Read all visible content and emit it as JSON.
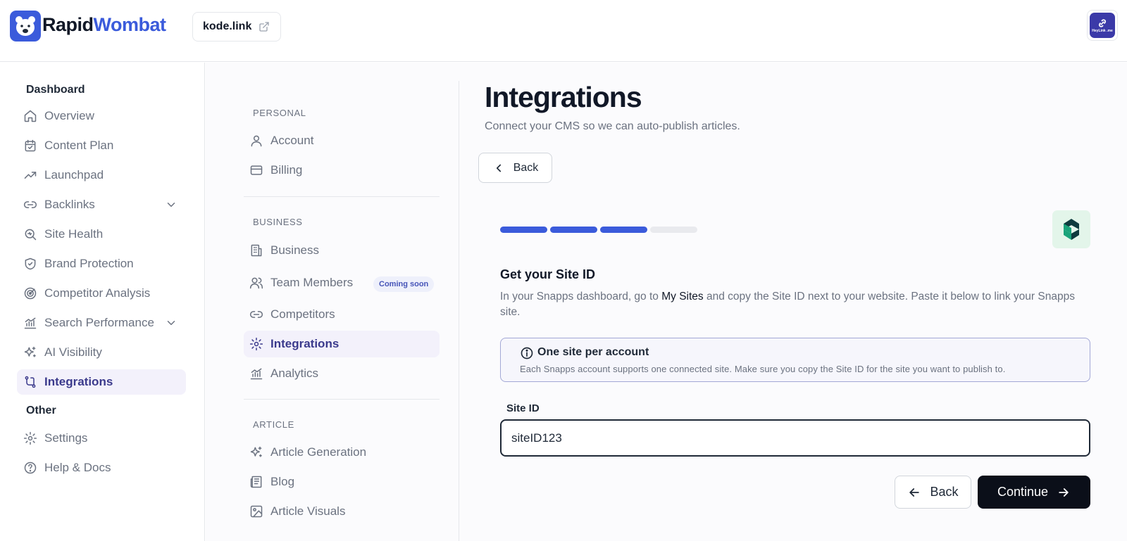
{
  "header": {
    "brand_part1": "Rapid",
    "brand_part2": "Wombat",
    "site_chip": "kode.link",
    "avatar_text": "HeyLink .me"
  },
  "sidebar": {
    "section_dashboard": "Dashboard",
    "section_other": "Other",
    "items": [
      {
        "label": "Overview",
        "icon": "home-icon"
      },
      {
        "label": "Content Plan",
        "icon": "calendar-icon"
      },
      {
        "label": "Launchpad",
        "icon": "trending-up-icon"
      },
      {
        "label": "Backlinks",
        "icon": "link-icon"
      },
      {
        "label": "Site Health",
        "icon": "search-health-icon"
      },
      {
        "label": "Brand Protection",
        "icon": "shield-icon"
      },
      {
        "label": "Competitor Analysis",
        "icon": "target-icon"
      },
      {
        "label": "Search Performance",
        "icon": "chart-icon"
      },
      {
        "label": "AI Visibility",
        "icon": "sparkle-icon"
      },
      {
        "label": "Integrations",
        "icon": "git-branch-icon"
      }
    ],
    "other_items": [
      {
        "label": "Settings",
        "icon": "gear-icon"
      },
      {
        "label": "Help & Docs",
        "icon": "help-icon"
      }
    ],
    "active": "Integrations"
  },
  "settings_nav": {
    "personal_label": "PERSONAL",
    "business_label": "BUSINESS",
    "article_label": "ARTICLE",
    "personal": [
      "Account",
      "Billing"
    ],
    "business": [
      "Business",
      "Team Members",
      "Competitors",
      "Integrations",
      "Analytics"
    ],
    "article": [
      "Article Generation",
      "Blog",
      "Article Visuals"
    ],
    "coming_soon": "Coming soon",
    "active": "Integrations"
  },
  "main": {
    "title": "Integrations",
    "subtitle": "Connect your CMS so we can auto-publish articles.",
    "back_top": "Back",
    "progress": {
      "completed_steps": 3,
      "total_steps": 4
    },
    "step_title": "Get your Site ID",
    "step_desc_1": "In your Snapps dashboard, go to",
    "step_desc_bold": "My Sites",
    "step_desc_2": "and copy the Site ID next to your website. Paste it below to link your Snapps site.",
    "alert_title": "One site per account",
    "alert_text": "Each Snapps account supports one connected site. Make sure you copy the Site ID for the site you want to publish to.",
    "field_label": "Site ID",
    "field_value": "siteID123",
    "btn_back": "Back",
    "btn_continue": "Continue"
  },
  "colors": {
    "accent": "#3b5bdb",
    "active_bg": "#f3f1fb",
    "active_text": "#3b3a8c",
    "primary_button": "#0b0f19"
  }
}
